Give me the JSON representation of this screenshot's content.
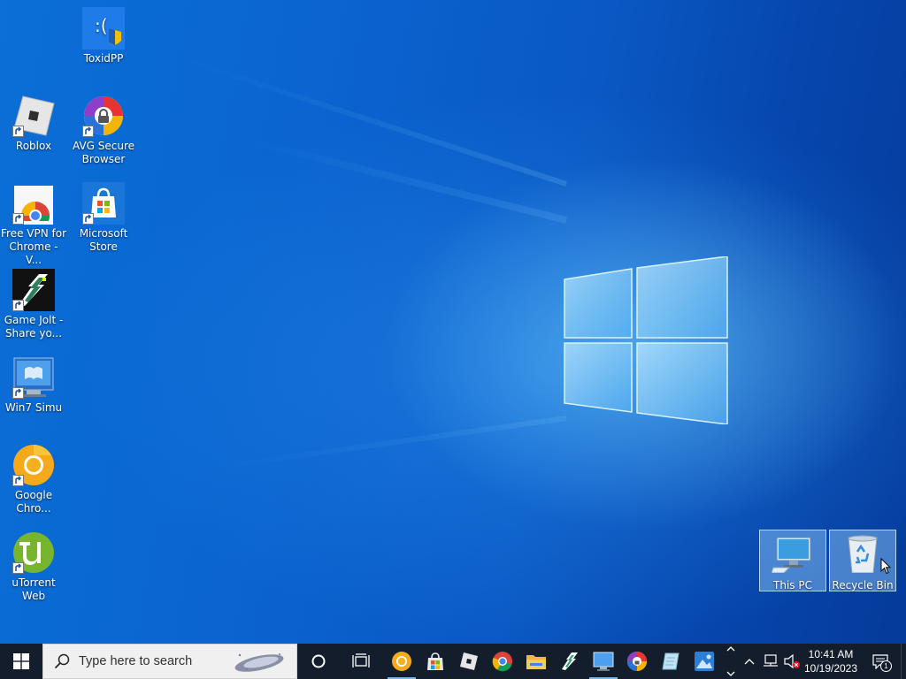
{
  "desktop": {
    "icons": [
      {
        "label": "ToxidPP",
        "icon": "toxidpp-icon"
      },
      {
        "label": "Roblox",
        "icon": "roblox-icon"
      },
      {
        "label": "AVG Secure Browser",
        "icon": "avg-browser-icon"
      },
      {
        "label": "Free VPN for Chrome - V...",
        "icon": "vpn-chrome-icon"
      },
      {
        "label": "Microsoft Store",
        "icon": "microsoft-store-icon"
      },
      {
        "label": "Game Jolt - Share yo...",
        "icon": "game-jolt-icon"
      },
      {
        "label": "Win7 Simu",
        "icon": "win7-simu-icon"
      },
      {
        "label": "Google Chro...",
        "icon": "google-chrome-icon"
      },
      {
        "label": "uTorrent Web",
        "icon": "utorrent-icon"
      },
      {
        "label": "This PC",
        "icon": "this-pc-icon"
      },
      {
        "label": "Recycle Bin",
        "icon": "recycle-bin-icon"
      }
    ]
  },
  "taskbar": {
    "search_placeholder": "Type here to search",
    "pinned": [
      "Google Chrome Canary",
      "Microsoft Store",
      "Roblox",
      "Google Chrome",
      "File Explorer",
      "Game Jolt",
      "Win7 Simu",
      "AVG Secure Browser",
      "Notepad",
      "Photos"
    ],
    "clock_time": "10:41 AM",
    "clock_date": "10/19/2023",
    "notification_count": "1"
  },
  "colors": {
    "taskbar_bg": "#141d2b",
    "desktop_bg": "#0a63cf",
    "selection": "#99d1ff"
  }
}
